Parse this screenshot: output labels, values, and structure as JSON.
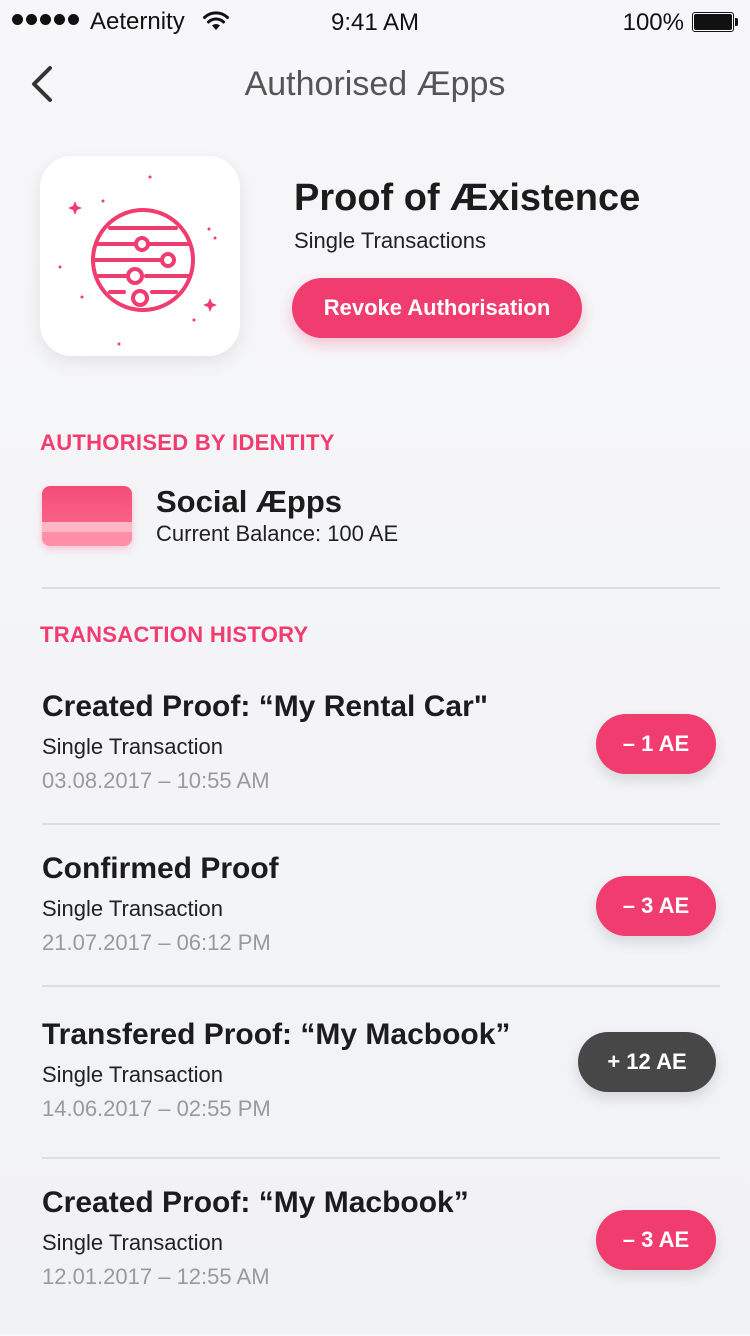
{
  "status_bar": {
    "carrier": "Aeternity",
    "time": "9:41 AM",
    "battery": "100%"
  },
  "nav": {
    "title": "Authorised Æpps",
    "back_icon": "chevron-left-icon"
  },
  "app": {
    "name": "Proof of Æxistence",
    "subtitle": "Single Transactions",
    "icon": "planet-icon",
    "revoke_label": "Revoke Authorisation"
  },
  "identity_section": {
    "label": "AUTHORISED BY IDENTITY",
    "name": "Social Æpps",
    "balance": "Current Balance: 100 AE"
  },
  "history_section": {
    "label": "TRANSACTION HISTORY",
    "items": [
      {
        "title": "Created Proof: “My Rental Car\"",
        "type": "Single Transaction",
        "date": "03.08.2017 – 10:55 AM",
        "amount": "– 1 AE",
        "kind": "debit"
      },
      {
        "title": "Confirmed Proof",
        "type": "Single Transaction",
        "date": "21.07.2017 – 06:12 PM",
        "amount": "– 3 AE",
        "kind": "debit"
      },
      {
        "title": "Transfered Proof: “My Macbook”",
        "type": "Single Transaction",
        "date": "14.06.2017 – 02:55 PM",
        "amount": "+ 12 AE",
        "kind": "credit"
      },
      {
        "title": "Created Proof: “My Macbook”",
        "type": "Single Transaction",
        "date": "12.01.2017 – 12:55 AM",
        "amount": "– 3 AE",
        "kind": "debit"
      }
    ]
  },
  "colors": {
    "accent": "#f03c6e",
    "credit": "#474747",
    "muted": "#9a9a9a"
  }
}
